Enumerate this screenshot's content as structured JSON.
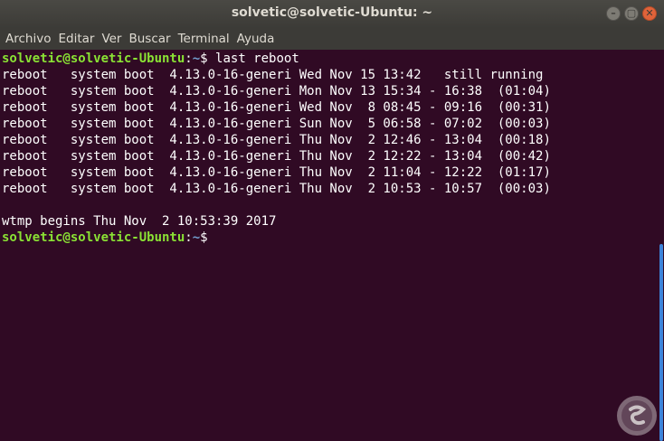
{
  "window": {
    "title": "solvetic@solvetic-Ubuntu: ~",
    "buttons": {
      "minimize": "–",
      "maximize": "▢",
      "close": "✕"
    }
  },
  "menu": [
    "Archivo",
    "Editar",
    "Ver",
    "Buscar",
    "Terminal",
    "Ayuda"
  ],
  "terminal": {
    "prompt_user": "solvetic@solvetic-Ubuntu",
    "prompt_sep": ":",
    "prompt_path": "~",
    "prompt_symbol": "$ ",
    "command": "last reboot",
    "output": [
      "reboot   system boot  4.13.0-16-generi Wed Nov 15 13:42   still running",
      "reboot   system boot  4.13.0-16-generi Mon Nov 13 15:34 - 16:38  (01:04)",
      "reboot   system boot  4.13.0-16-generi Wed Nov  8 08:45 - 09:16  (00:31)",
      "reboot   system boot  4.13.0-16-generi Sun Nov  5 06:58 - 07:02  (00:03)",
      "reboot   system boot  4.13.0-16-generi Thu Nov  2 12:46 - 13:04  (00:18)",
      "reboot   system boot  4.13.0-16-generi Thu Nov  2 12:22 - 13:04  (00:42)",
      "reboot   system boot  4.13.0-16-generi Thu Nov  2 11:04 - 12:22  (01:17)",
      "reboot   system boot  4.13.0-16-generi Thu Nov  2 10:53 - 10:57  (00:03)",
      "",
      "wtmp begins Thu Nov  2 10:53:39 2017"
    ]
  },
  "colors": {
    "background": "#300a24",
    "prompt_user": "#8ae234",
    "prompt_path": "#729fcf",
    "scroll_thumb": "#3d83d9"
  },
  "watermark_icon": "solvetic-logo-icon"
}
